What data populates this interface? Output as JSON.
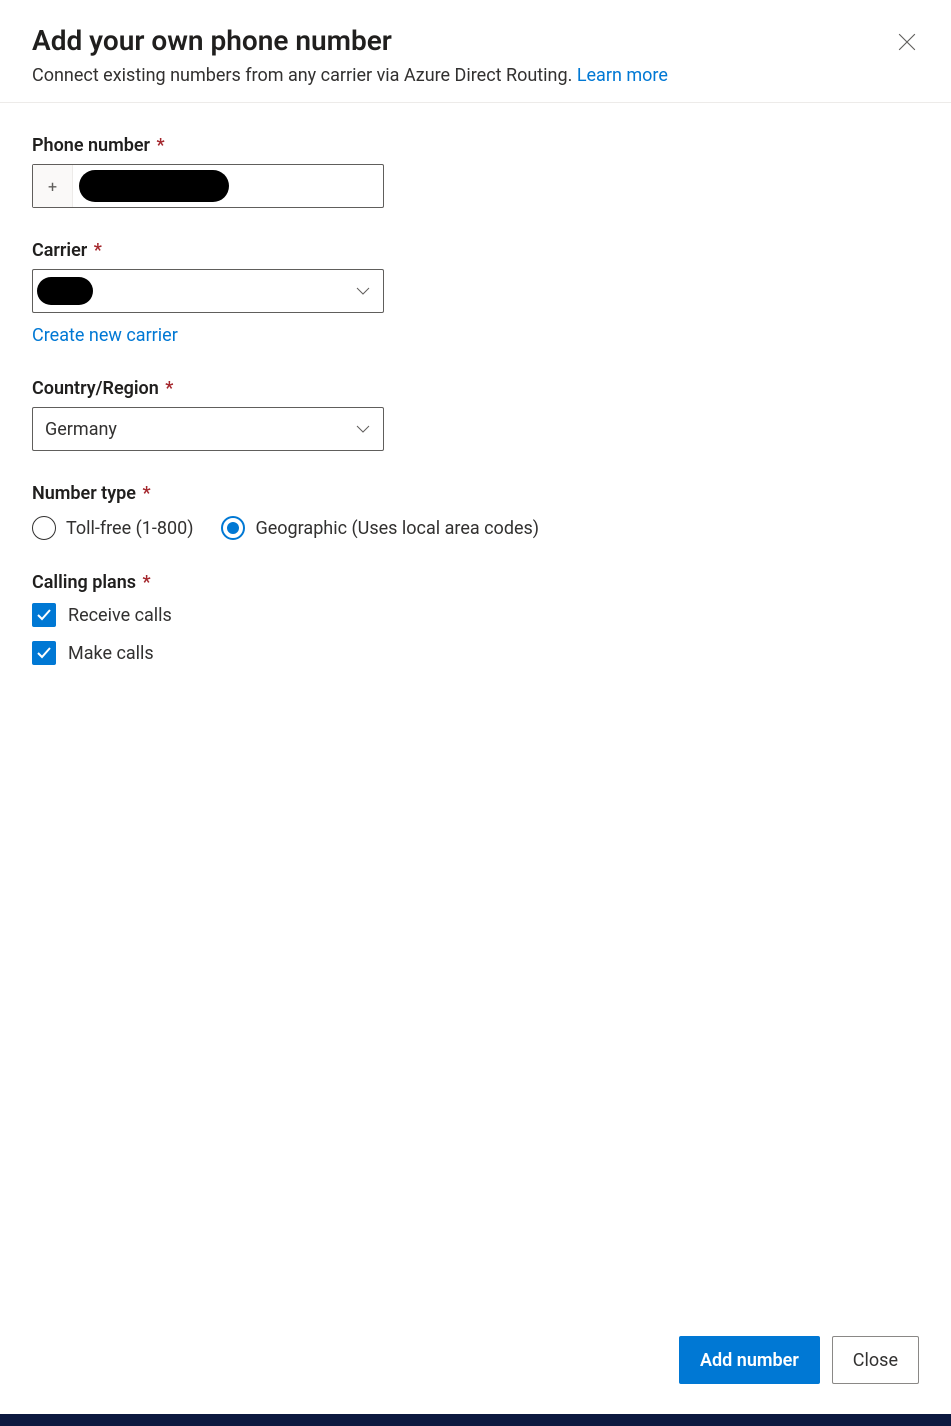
{
  "header": {
    "title": "Add your own phone number",
    "subtitle_prefix": "Connect existing numbers from any carrier via Azure Direct Routing. ",
    "learn_more": "Learn more"
  },
  "phone_number": {
    "label": "Phone number",
    "prefix": "+",
    "value": ""
  },
  "carrier": {
    "label": "Carrier",
    "selected": "",
    "create_link": "Create new carrier"
  },
  "country": {
    "label": "Country/Region",
    "selected": "Germany"
  },
  "number_type": {
    "label": "Number type",
    "options": [
      {
        "label": "Toll-free (1-800)",
        "selected": false
      },
      {
        "label": "Geographic (Uses local area codes)",
        "selected": true
      }
    ]
  },
  "calling_plans": {
    "label": "Calling plans",
    "options": [
      {
        "label": "Receive calls",
        "checked": true
      },
      {
        "label": "Make calls",
        "checked": true
      }
    ]
  },
  "footer": {
    "primary": "Add number",
    "secondary": "Close"
  }
}
